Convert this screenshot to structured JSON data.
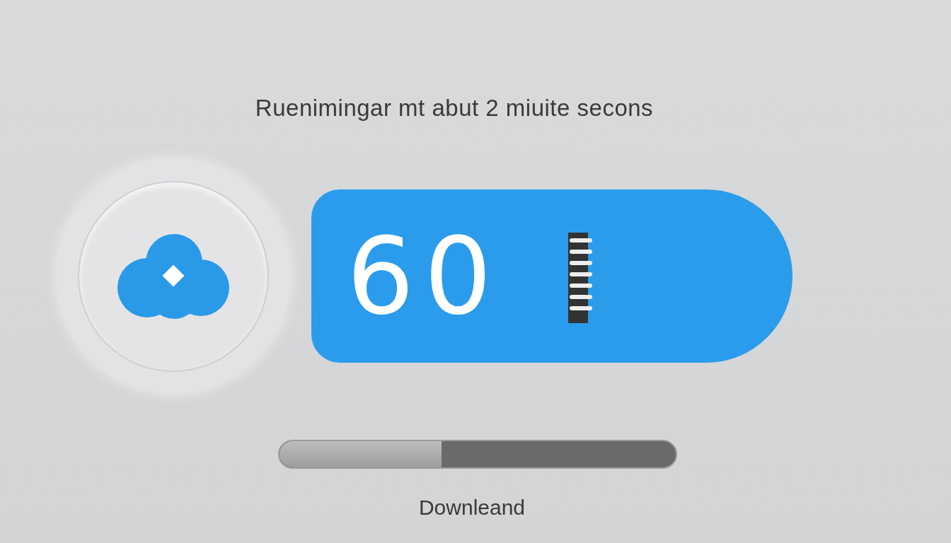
{
  "status_text": "Ruenimingar mt abut 2 miuite secons",
  "timer": {
    "value": "60"
  },
  "progress": {
    "level": 0.41
  },
  "action_label": "Downleand"
}
